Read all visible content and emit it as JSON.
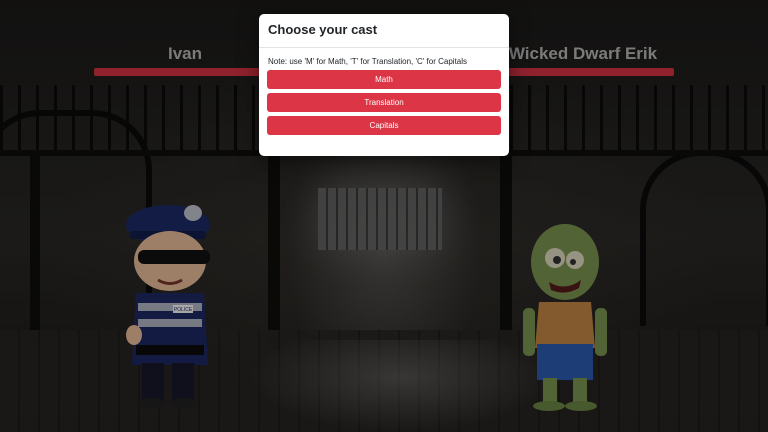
{
  "player": {
    "name": "Ivan",
    "hp_fraction": 1.0
  },
  "enemy": {
    "name": "Wicked Dwarf Erik",
    "hp_fraction": 1.0
  },
  "modal": {
    "title": "Choose your cast",
    "note": "Note: use 'M' for Math, 'T' for Translation, 'C' for Capitals",
    "buttons": [
      {
        "label": "Math"
      },
      {
        "label": "Translation"
      },
      {
        "label": "Capitals"
      }
    ]
  },
  "colors": {
    "accent": "#dc3545",
    "modal_bg": "#ffffff"
  },
  "player_badge": "POLICE"
}
